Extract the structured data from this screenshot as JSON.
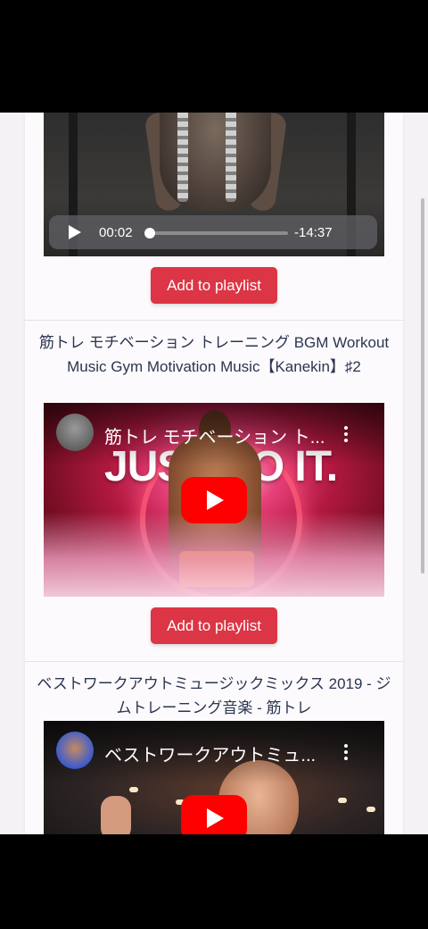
{
  "video1": {
    "current_time": "00:02",
    "remaining_time": "-14:37",
    "progress": 0.002
  },
  "items": [
    {
      "add_label": "Add to playlist"
    },
    {
      "title": "筋トレ モチベーション トレーニング BGM Workout Music Gym Motivation Music【Kanekin】♯2",
      "embed_title": "筋トレ モチベーション ト...",
      "thumb_text": "JUST DO IT.",
      "add_label": "Add to playlist"
    },
    {
      "title": "ベストワークアウトミュージックミックス 2019 - ジムトレーニング音楽 - 筋トレ",
      "embed_title": "ベストワークアウトミュ..."
    }
  ],
  "icons": {
    "play": "play-icon",
    "youtube_play": "youtube-play-icon",
    "more": "more-vertical-icon",
    "avatar": "channel-avatar"
  },
  "colors": {
    "button": "#dc3545",
    "title_text": "#2b3550",
    "youtube_red": "#ff0000"
  }
}
